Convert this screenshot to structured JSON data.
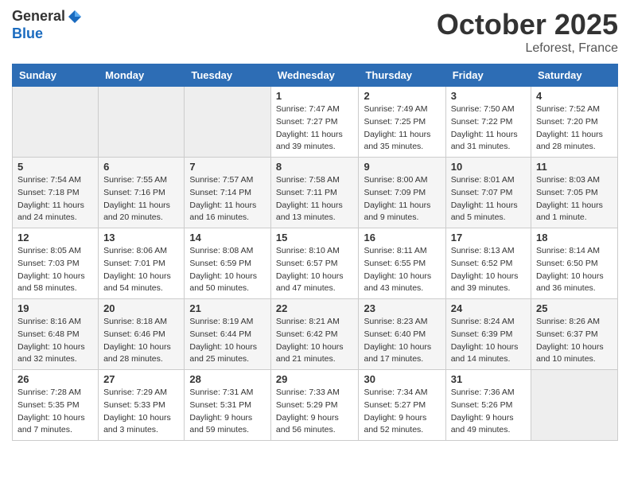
{
  "header": {
    "logo_general": "General",
    "logo_blue": "Blue",
    "month_title": "October 2025",
    "location": "Leforest, France"
  },
  "days_of_week": [
    "Sunday",
    "Monday",
    "Tuesday",
    "Wednesday",
    "Thursday",
    "Friday",
    "Saturday"
  ],
  "weeks": [
    [
      {
        "day": "",
        "info": ""
      },
      {
        "day": "",
        "info": ""
      },
      {
        "day": "",
        "info": ""
      },
      {
        "day": "1",
        "info": "Sunrise: 7:47 AM\nSunset: 7:27 PM\nDaylight: 11 hours and 39 minutes."
      },
      {
        "day": "2",
        "info": "Sunrise: 7:49 AM\nSunset: 7:25 PM\nDaylight: 11 hours and 35 minutes."
      },
      {
        "day": "3",
        "info": "Sunrise: 7:50 AM\nSunset: 7:22 PM\nDaylight: 11 hours and 31 minutes."
      },
      {
        "day": "4",
        "info": "Sunrise: 7:52 AM\nSunset: 7:20 PM\nDaylight: 11 hours and 28 minutes."
      }
    ],
    [
      {
        "day": "5",
        "info": "Sunrise: 7:54 AM\nSunset: 7:18 PM\nDaylight: 11 hours and 24 minutes."
      },
      {
        "day": "6",
        "info": "Sunrise: 7:55 AM\nSunset: 7:16 PM\nDaylight: 11 hours and 20 minutes."
      },
      {
        "day": "7",
        "info": "Sunrise: 7:57 AM\nSunset: 7:14 PM\nDaylight: 11 hours and 16 minutes."
      },
      {
        "day": "8",
        "info": "Sunrise: 7:58 AM\nSunset: 7:11 PM\nDaylight: 11 hours and 13 minutes."
      },
      {
        "day": "9",
        "info": "Sunrise: 8:00 AM\nSunset: 7:09 PM\nDaylight: 11 hours and 9 minutes."
      },
      {
        "day": "10",
        "info": "Sunrise: 8:01 AM\nSunset: 7:07 PM\nDaylight: 11 hours and 5 minutes."
      },
      {
        "day": "11",
        "info": "Sunrise: 8:03 AM\nSunset: 7:05 PM\nDaylight: 11 hours and 1 minute."
      }
    ],
    [
      {
        "day": "12",
        "info": "Sunrise: 8:05 AM\nSunset: 7:03 PM\nDaylight: 10 hours and 58 minutes."
      },
      {
        "day": "13",
        "info": "Sunrise: 8:06 AM\nSunset: 7:01 PM\nDaylight: 10 hours and 54 minutes."
      },
      {
        "day": "14",
        "info": "Sunrise: 8:08 AM\nSunset: 6:59 PM\nDaylight: 10 hours and 50 minutes."
      },
      {
        "day": "15",
        "info": "Sunrise: 8:10 AM\nSunset: 6:57 PM\nDaylight: 10 hours and 47 minutes."
      },
      {
        "day": "16",
        "info": "Sunrise: 8:11 AM\nSunset: 6:55 PM\nDaylight: 10 hours and 43 minutes."
      },
      {
        "day": "17",
        "info": "Sunrise: 8:13 AM\nSunset: 6:52 PM\nDaylight: 10 hours and 39 minutes."
      },
      {
        "day": "18",
        "info": "Sunrise: 8:14 AM\nSunset: 6:50 PM\nDaylight: 10 hours and 36 minutes."
      }
    ],
    [
      {
        "day": "19",
        "info": "Sunrise: 8:16 AM\nSunset: 6:48 PM\nDaylight: 10 hours and 32 minutes."
      },
      {
        "day": "20",
        "info": "Sunrise: 8:18 AM\nSunset: 6:46 PM\nDaylight: 10 hours and 28 minutes."
      },
      {
        "day": "21",
        "info": "Sunrise: 8:19 AM\nSunset: 6:44 PM\nDaylight: 10 hours and 25 minutes."
      },
      {
        "day": "22",
        "info": "Sunrise: 8:21 AM\nSunset: 6:42 PM\nDaylight: 10 hours and 21 minutes."
      },
      {
        "day": "23",
        "info": "Sunrise: 8:23 AM\nSunset: 6:40 PM\nDaylight: 10 hours and 17 minutes."
      },
      {
        "day": "24",
        "info": "Sunrise: 8:24 AM\nSunset: 6:39 PM\nDaylight: 10 hours and 14 minutes."
      },
      {
        "day": "25",
        "info": "Sunrise: 8:26 AM\nSunset: 6:37 PM\nDaylight: 10 hours and 10 minutes."
      }
    ],
    [
      {
        "day": "26",
        "info": "Sunrise: 7:28 AM\nSunset: 5:35 PM\nDaylight: 10 hours and 7 minutes."
      },
      {
        "day": "27",
        "info": "Sunrise: 7:29 AM\nSunset: 5:33 PM\nDaylight: 10 hours and 3 minutes."
      },
      {
        "day": "28",
        "info": "Sunrise: 7:31 AM\nSunset: 5:31 PM\nDaylight: 9 hours and 59 minutes."
      },
      {
        "day": "29",
        "info": "Sunrise: 7:33 AM\nSunset: 5:29 PM\nDaylight: 9 hours and 56 minutes."
      },
      {
        "day": "30",
        "info": "Sunrise: 7:34 AM\nSunset: 5:27 PM\nDaylight: 9 hours and 52 minutes."
      },
      {
        "day": "31",
        "info": "Sunrise: 7:36 AM\nSunset: 5:26 PM\nDaylight: 9 hours and 49 minutes."
      },
      {
        "day": "",
        "info": ""
      }
    ]
  ]
}
